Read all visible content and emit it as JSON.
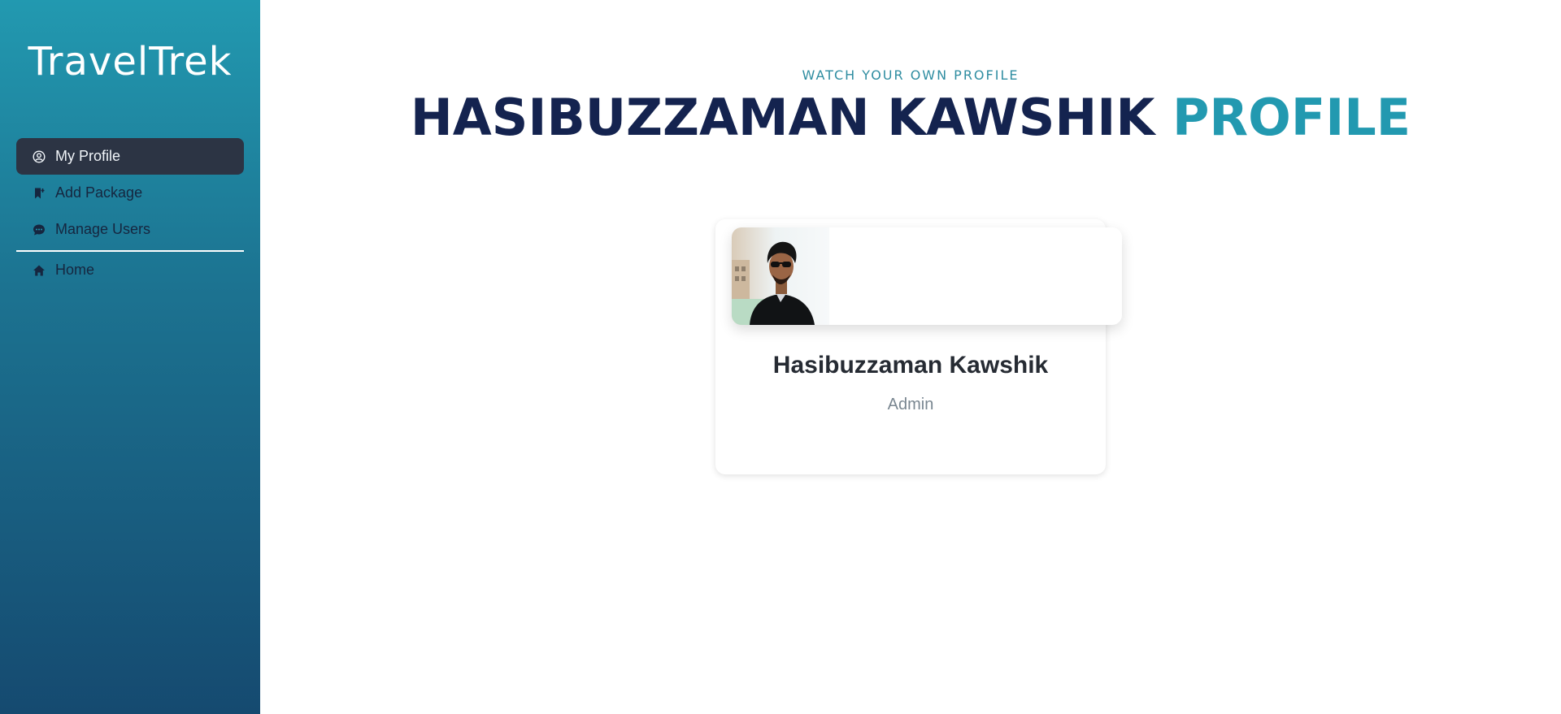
{
  "sidebar": {
    "brand": "TravelTrek",
    "items": [
      {
        "label": "My Profile",
        "icon": "user-circle-icon",
        "active": true
      },
      {
        "label": "Add Package",
        "icon": "bookmark-plus-icon",
        "active": false
      },
      {
        "label": "Manage Users",
        "icon": "chat-bubble-icon",
        "active": false
      }
    ],
    "home": {
      "label": "Home",
      "icon": "home-icon"
    }
  },
  "main": {
    "subtitle": "WATCH YOUR OWN PROFILE",
    "headline_name": "HASIBUZZAMAN KAWSHIK",
    "headline_accent": "PROFILE"
  },
  "profile": {
    "name": "Hasibuzzaman Kawshik",
    "role": "Admin"
  },
  "colors": {
    "accent": "#2299b0",
    "navy": "#14234f",
    "active_nav": "#2c3444"
  }
}
